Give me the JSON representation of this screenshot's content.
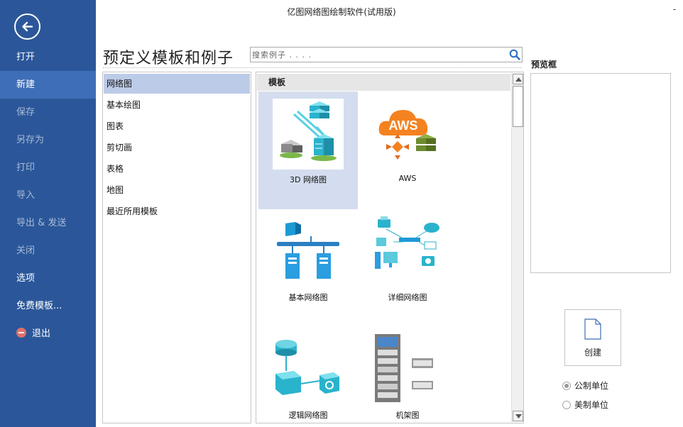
{
  "window": {
    "title": "亿图网络图绘制软件(试用版)",
    "minimize_label": "-"
  },
  "sidebar": {
    "items": [
      {
        "label": "打开",
        "state": "enabled"
      },
      {
        "label": "新建",
        "state": "active"
      },
      {
        "label": "保存",
        "state": "disabled"
      },
      {
        "label": "另存为",
        "state": "disabled"
      },
      {
        "label": "打印",
        "state": "disabled"
      },
      {
        "label": "导入",
        "state": "disabled"
      },
      {
        "label": "导出 & 发送",
        "state": "disabled"
      },
      {
        "label": "关闭",
        "state": "disabled"
      },
      {
        "label": "选项",
        "state": "enabled"
      },
      {
        "label": "免费模板...",
        "state": "enabled"
      },
      {
        "label": "退出",
        "state": "enabled"
      }
    ]
  },
  "main": {
    "heading": "预定义模板和例子",
    "search": {
      "placeholder": "搜索例子 . . . ."
    }
  },
  "categories": [
    {
      "label": "网络图",
      "selected": true
    },
    {
      "label": "基本绘图",
      "selected": false
    },
    {
      "label": "图表",
      "selected": false
    },
    {
      "label": "剪切画",
      "selected": false
    },
    {
      "label": "表格",
      "selected": false
    },
    {
      "label": "地图",
      "selected": false
    },
    {
      "label": "最近所用模板",
      "selected": false
    }
  ],
  "templates": {
    "header": "模板",
    "items": [
      {
        "label": "3D 网络图",
        "icon": "3d-network-thumbnail",
        "selected": true
      },
      {
        "label": "AWS",
        "icon": "aws-thumbnail",
        "thumb_text": "AWS",
        "selected": false
      },
      {
        "label": "基本网络图",
        "icon": "basic-network-thumbnail",
        "selected": false
      },
      {
        "label": "详细网络图",
        "icon": "detailed-network-thumbnail",
        "selected": false
      },
      {
        "label": "逻辑网络图",
        "icon": "logical-network-thumbnail",
        "selected": false
      },
      {
        "label": "机架图",
        "icon": "rack-diagram-thumbnail",
        "selected": false
      }
    ]
  },
  "preview": {
    "title": "预览框"
  },
  "create": {
    "label": "创建"
  },
  "units": {
    "options": [
      {
        "label": "公制单位",
        "checked": true
      },
      {
        "label": "美制单位",
        "checked": false
      }
    ]
  },
  "colors": {
    "sidebar": "#2b579a",
    "sidebar_active": "#3f6eb8",
    "category_selected": "#bccbe8",
    "template_selected": "#d4ddef"
  }
}
